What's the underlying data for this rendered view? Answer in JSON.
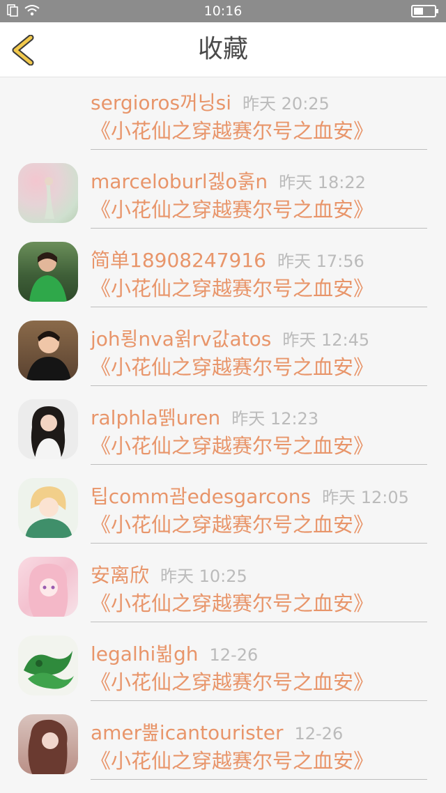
{
  "status_bar": {
    "time": "10:16"
  },
  "header": {
    "title": "收藏",
    "back_icon": "chevron-left-icon"
  },
  "colors": {
    "accent": "#e8956a",
    "back": "#f2c94c",
    "time": "#bbbbbb"
  },
  "items": [
    {
      "username": "sergioros꺼닝si",
      "time": "昨天 20:25",
      "book": "《小花仙之穿越赛尔号之血安》"
    },
    {
      "username": "marceloburl겛o훍n",
      "time": "昨天 18:22",
      "book": "《小花仙之穿越赛尔号之血安》"
    },
    {
      "username": "简单18908247916",
      "time": "昨天 17:56",
      "book": "《小花仙之穿越赛尔号之血安》"
    },
    {
      "username": "joh룅nva윍rv값atos",
      "time": "昨天 12:45",
      "book": "《小花仙之穿越赛尔号之血安》"
    },
    {
      "username": "ralphla뗅uren",
      "time": "昨天 12:23",
      "book": "《小花仙之穿越赛尔号之血安》"
    },
    {
      "username": "팁comm괌edesgarcons",
      "time": "昨天 12:05",
      "book": "《小花仙之穿越赛尔号之血安》"
    },
    {
      "username": "安离欣",
      "time": "昨天 10:25",
      "book": "《小花仙之穿越赛尔号之血安》"
    },
    {
      "username": "legalhi뷞gh",
      "time": "12-26",
      "book": "《小花仙之穿越赛尔号之血安》"
    },
    {
      "username": "amer뿚icantourister",
      "time": "12-26",
      "book": "《小花仙之穿越赛尔号之血安》"
    }
  ]
}
